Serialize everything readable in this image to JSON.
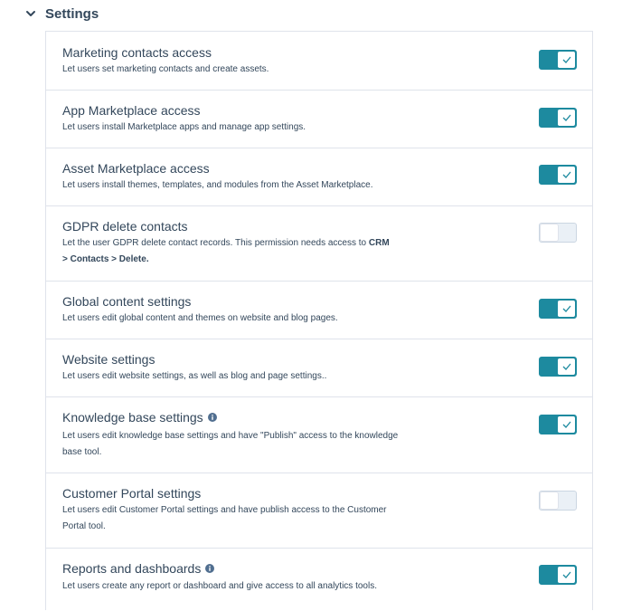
{
  "section": {
    "title": "Settings"
  },
  "rows": [
    {
      "title": "Marketing contacts access",
      "desc": "Let users set marketing contacts and create assets.",
      "enabled": true
    },
    {
      "title": "App Marketplace access",
      "desc": "Let users install Marketplace apps and manage app settings.",
      "enabled": true
    },
    {
      "title": "Asset Marketplace access",
      "desc": "Let users install themes, templates, and modules from the Asset Marketplace.",
      "enabled": true
    },
    {
      "title": "GDPR delete contacts",
      "desc_prefix": "Let the user GDPR delete contact records. This permission needs access to ",
      "desc_bold": "CRM > Contacts > Delete.",
      "enabled": false
    },
    {
      "title": "Global content settings",
      "desc": "Let users edit global content and themes on website and blog pages.",
      "enabled": true
    },
    {
      "title": "Website settings",
      "desc": "Let users edit website settings, as well as blog and page settings..",
      "enabled": true
    },
    {
      "title": "Knowledge base settings",
      "desc": "Let users edit knowledge base settings and have \"Publish\" access to the knowledge base tool.",
      "enabled": true,
      "info_icon": "info-icon"
    },
    {
      "title": "Customer Portal settings",
      "desc": "Let users edit Customer Portal settings and have publish access to the Customer Portal tool.",
      "enabled": false
    },
    {
      "title": "Reports and dashboards",
      "desc": "Let users create any report or dashboard and give access to all analytics tools.",
      "enabled": true,
      "info_icon": "info-icon"
    }
  ],
  "colors": {
    "toggle_on": "#1d8a9f",
    "toggle_off": "#eaf0f6",
    "text": "#33475b",
    "border": "#dfe3eb"
  }
}
